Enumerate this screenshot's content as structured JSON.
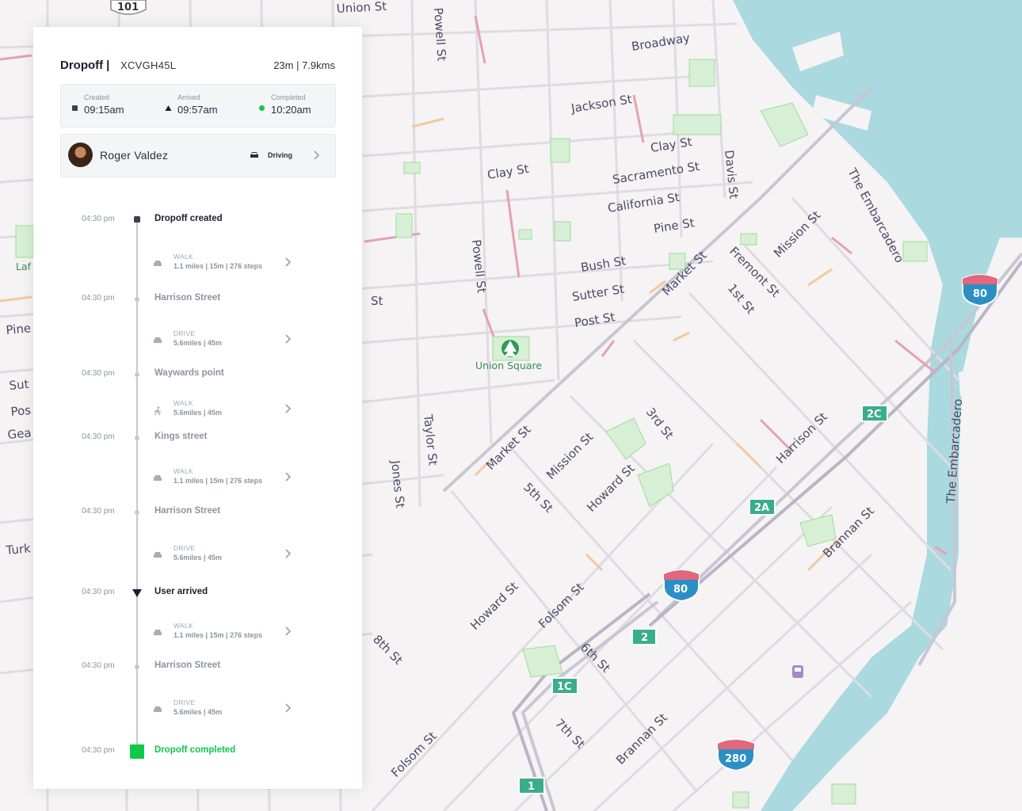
{
  "header": {
    "title": "Dropoff",
    "separator": "|",
    "code": "XCVGH45L",
    "meta": "23m | 7.9kms"
  },
  "times": [
    {
      "label": "Created",
      "value": "09:15am",
      "icon": "square-icon"
    },
    {
      "label": "Arrived",
      "value": "09:57am",
      "icon": "triangle-icon"
    },
    {
      "label": "Completed",
      "value": "10:20am",
      "icon": "green-dot-icon"
    }
  ],
  "driver": {
    "name": "Roger Valdez",
    "status": "Driving"
  },
  "events": [
    {
      "time": "04:30 pm",
      "name": "Dropoff created"
    },
    {
      "time": "04:30 pm",
      "name": "Harrison Street"
    },
    {
      "time": "04:30 pm",
      "name": "Waywards point"
    },
    {
      "time": "04:30 pm",
      "name": "Kings street"
    },
    {
      "time": "04:30 pm",
      "name": "Harrison Street"
    },
    {
      "time": "04:30 pm",
      "name": "User arrived"
    },
    {
      "time": "04:30 pm",
      "name": "Harrison Street"
    },
    {
      "time": "04:30 pm",
      "name": "Dropoff completed"
    }
  ],
  "legs": [
    {
      "mode": "WALK",
      "detail": "1.1 miles | 15m | 276 steps",
      "icon": "car-icon"
    },
    {
      "mode": "DRIVE",
      "detail": "5.6miles | 45m",
      "icon": "car-icon"
    },
    {
      "mode": "WALK",
      "detail": "5.6miles | 45m",
      "icon": "walk-icon"
    },
    {
      "mode": "WALK",
      "detail": "1.1 miles | 15m | 276 steps",
      "icon": "car-icon"
    },
    {
      "mode": "DRIVE",
      "detail": "5.6miles | 45m",
      "icon": "car-icon"
    },
    {
      "mode": "WALK",
      "detail": "1.1 miles | 15m | 276 steps",
      "icon": "car-icon"
    },
    {
      "mode": "DRIVE",
      "detail": "5.6miles | 45m",
      "icon": "car-icon"
    }
  ],
  "map": {
    "shields": {
      "us101": "101",
      "i80_a": "80",
      "i80_b": "80",
      "i280": "280"
    },
    "exits": {
      "e2c": "2C",
      "e2a": "2A",
      "e2": "2",
      "e1c": "1C",
      "e1": "1"
    },
    "park": "Union Square",
    "streets": {
      "union": "Union St",
      "powell": "Powell St",
      "broadway": "Broadway",
      "jackson": "Jackson St",
      "clay1": "Clay St",
      "clay2": "Clay St",
      "sacramento": "Sacramento St",
      "california": "California St",
      "davis": "Davis St",
      "pine": "Pine St",
      "bush": "Bush St",
      "sutter": "Sutter St",
      "post": "Post St",
      "powell2": "Powell St",
      "market1": "Market St",
      "market2": "Market St",
      "fremont": "Fremont St",
      "first": "1st St",
      "mission1": "Mission St",
      "mission2": "Mission St",
      "embarcadero1": "The Embarcadero",
      "embarcadero2": "The Embarcadero",
      "harrison": "Harrison St",
      "third": "3rd St",
      "howard1": "Howard St",
      "howard2": "Howard St",
      "fifth": "5th St",
      "taylor": "Taylor St",
      "jones": "Jones St",
      "folsom1": "Folsom St",
      "folsom2": "Folsom St",
      "brannan1": "Brannan St",
      "brannan2": "Brannan St",
      "sixth": "6th St",
      "seventh": "7th St",
      "eighth": "8th St",
      "left_st": "St",
      "pine_l": "Pine",
      "sut_l": "Sut",
      "pos_l": "Pos",
      "gea_l": "Gea",
      "turk_l": "Turk",
      "laf_l": "Laf"
    }
  }
}
